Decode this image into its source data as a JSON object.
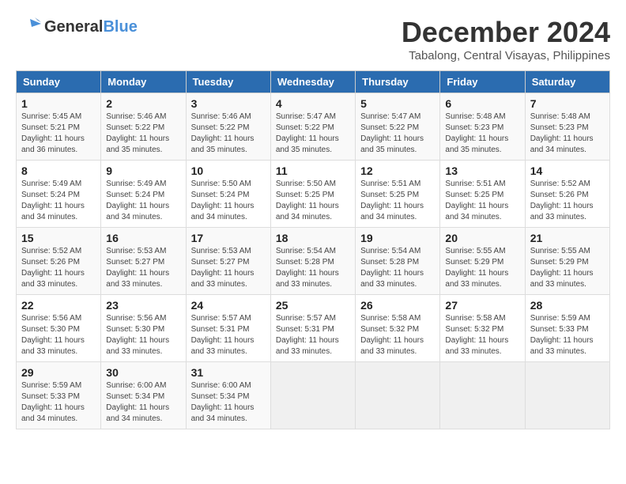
{
  "logo": {
    "part1": "General",
    "part2": "Blue"
  },
  "title": {
    "month": "December 2024",
    "location": "Tabalong, Central Visayas, Philippines"
  },
  "days_of_week": [
    "Sunday",
    "Monday",
    "Tuesday",
    "Wednesday",
    "Thursday",
    "Friday",
    "Saturday"
  ],
  "weeks": [
    [
      {
        "day": "1",
        "sunrise": "5:45 AM",
        "sunset": "5:21 PM",
        "daylight": "11 hours and 36 minutes."
      },
      {
        "day": "2",
        "sunrise": "5:46 AM",
        "sunset": "5:22 PM",
        "daylight": "11 hours and 35 minutes."
      },
      {
        "day": "3",
        "sunrise": "5:46 AM",
        "sunset": "5:22 PM",
        "daylight": "11 hours and 35 minutes."
      },
      {
        "day": "4",
        "sunrise": "5:47 AM",
        "sunset": "5:22 PM",
        "daylight": "11 hours and 35 minutes."
      },
      {
        "day": "5",
        "sunrise": "5:47 AM",
        "sunset": "5:22 PM",
        "daylight": "11 hours and 35 minutes."
      },
      {
        "day": "6",
        "sunrise": "5:48 AM",
        "sunset": "5:23 PM",
        "daylight": "11 hours and 35 minutes."
      },
      {
        "day": "7",
        "sunrise": "5:48 AM",
        "sunset": "5:23 PM",
        "daylight": "11 hours and 34 minutes."
      }
    ],
    [
      {
        "day": "8",
        "sunrise": "5:49 AM",
        "sunset": "5:24 PM",
        "daylight": "11 hours and 34 minutes."
      },
      {
        "day": "9",
        "sunrise": "5:49 AM",
        "sunset": "5:24 PM",
        "daylight": "11 hours and 34 minutes."
      },
      {
        "day": "10",
        "sunrise": "5:50 AM",
        "sunset": "5:24 PM",
        "daylight": "11 hours and 34 minutes."
      },
      {
        "day": "11",
        "sunrise": "5:50 AM",
        "sunset": "5:25 PM",
        "daylight": "11 hours and 34 minutes."
      },
      {
        "day": "12",
        "sunrise": "5:51 AM",
        "sunset": "5:25 PM",
        "daylight": "11 hours and 34 minutes."
      },
      {
        "day": "13",
        "sunrise": "5:51 AM",
        "sunset": "5:25 PM",
        "daylight": "11 hours and 34 minutes."
      },
      {
        "day": "14",
        "sunrise": "5:52 AM",
        "sunset": "5:26 PM",
        "daylight": "11 hours and 33 minutes."
      }
    ],
    [
      {
        "day": "15",
        "sunrise": "5:52 AM",
        "sunset": "5:26 PM",
        "daylight": "11 hours and 33 minutes."
      },
      {
        "day": "16",
        "sunrise": "5:53 AM",
        "sunset": "5:27 PM",
        "daylight": "11 hours and 33 minutes."
      },
      {
        "day": "17",
        "sunrise": "5:53 AM",
        "sunset": "5:27 PM",
        "daylight": "11 hours and 33 minutes."
      },
      {
        "day": "18",
        "sunrise": "5:54 AM",
        "sunset": "5:28 PM",
        "daylight": "11 hours and 33 minutes."
      },
      {
        "day": "19",
        "sunrise": "5:54 AM",
        "sunset": "5:28 PM",
        "daylight": "11 hours and 33 minutes."
      },
      {
        "day": "20",
        "sunrise": "5:55 AM",
        "sunset": "5:29 PM",
        "daylight": "11 hours and 33 minutes."
      },
      {
        "day": "21",
        "sunrise": "5:55 AM",
        "sunset": "5:29 PM",
        "daylight": "11 hours and 33 minutes."
      }
    ],
    [
      {
        "day": "22",
        "sunrise": "5:56 AM",
        "sunset": "5:30 PM",
        "daylight": "11 hours and 33 minutes."
      },
      {
        "day": "23",
        "sunrise": "5:56 AM",
        "sunset": "5:30 PM",
        "daylight": "11 hours and 33 minutes."
      },
      {
        "day": "24",
        "sunrise": "5:57 AM",
        "sunset": "5:31 PM",
        "daylight": "11 hours and 33 minutes."
      },
      {
        "day": "25",
        "sunrise": "5:57 AM",
        "sunset": "5:31 PM",
        "daylight": "11 hours and 33 minutes."
      },
      {
        "day": "26",
        "sunrise": "5:58 AM",
        "sunset": "5:32 PM",
        "daylight": "11 hours and 33 minutes."
      },
      {
        "day": "27",
        "sunrise": "5:58 AM",
        "sunset": "5:32 PM",
        "daylight": "11 hours and 33 minutes."
      },
      {
        "day": "28",
        "sunrise": "5:59 AM",
        "sunset": "5:33 PM",
        "daylight": "11 hours and 33 minutes."
      }
    ],
    [
      {
        "day": "29",
        "sunrise": "5:59 AM",
        "sunset": "5:33 PM",
        "daylight": "11 hours and 34 minutes."
      },
      {
        "day": "30",
        "sunrise": "6:00 AM",
        "sunset": "5:34 PM",
        "daylight": "11 hours and 34 minutes."
      },
      {
        "day": "31",
        "sunrise": "6:00 AM",
        "sunset": "5:34 PM",
        "daylight": "11 hours and 34 minutes."
      },
      null,
      null,
      null,
      null
    ]
  ],
  "labels": {
    "sunrise": "Sunrise:",
    "sunset": "Sunset:",
    "daylight": "Daylight:"
  }
}
